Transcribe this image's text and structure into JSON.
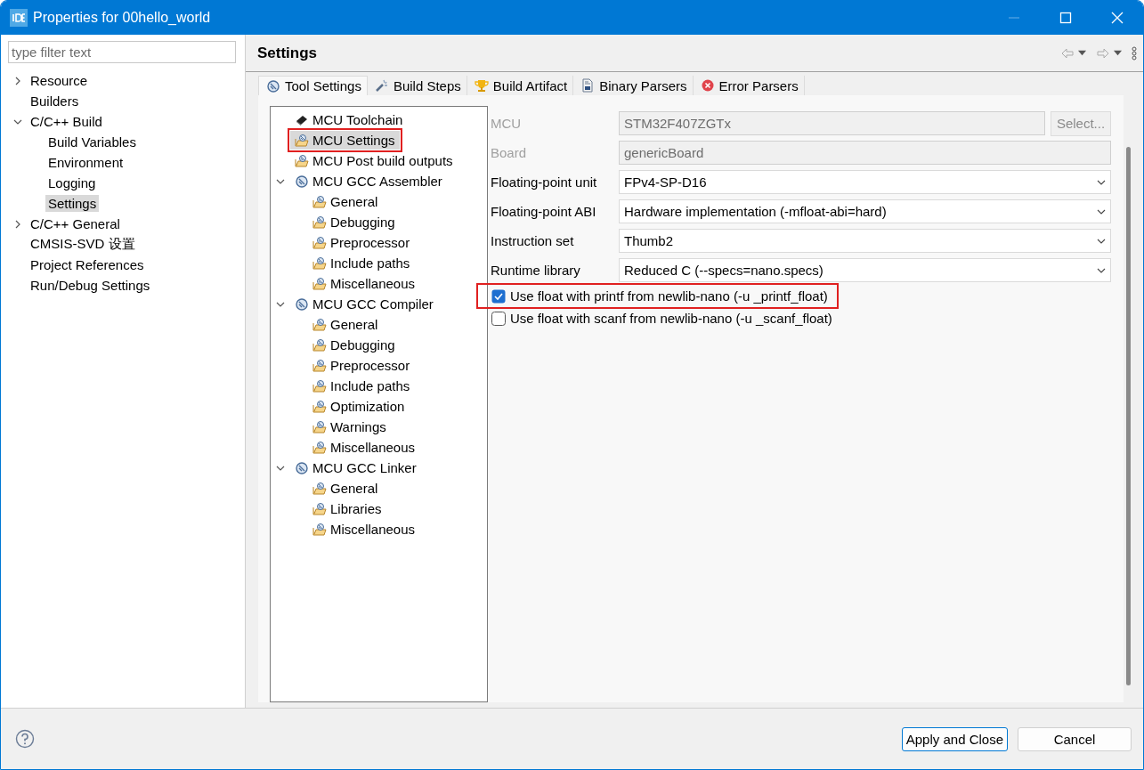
{
  "window": {
    "title": "Properties for 00hello_world"
  },
  "filter": {
    "placeholder": "type filter text"
  },
  "nav_tree": [
    {
      "label": "Resource",
      "expanded": false,
      "selected": false
    },
    {
      "label": "Builders",
      "selected": false
    },
    {
      "label": "C/C++ Build",
      "expanded": true,
      "selected": false,
      "children": [
        {
          "label": "Build Variables",
          "selected": false
        },
        {
          "label": "Environment",
          "selected": false
        },
        {
          "label": "Logging",
          "selected": false
        },
        {
          "label": "Settings",
          "selected": true
        }
      ]
    },
    {
      "label": "C/C++ General",
      "expanded": false,
      "selected": false
    },
    {
      "label": "CMSIS-SVD 设置",
      "selected": false
    },
    {
      "label": "Project References",
      "selected": false
    },
    {
      "label": "Run/Debug Settings",
      "selected": false
    }
  ],
  "page_title": "Settings",
  "tabs": [
    {
      "label": "Tool Settings",
      "kind": "tool",
      "selected": true
    },
    {
      "label": "Build Steps",
      "kind": "steps",
      "selected": false
    },
    {
      "label": "Build Artifact",
      "kind": "artifact",
      "selected": false
    },
    {
      "label": "Binary Parsers",
      "kind": "binary",
      "selected": false
    },
    {
      "label": "Error Parsers",
      "kind": "error",
      "selected": false
    }
  ],
  "tool_tree": [
    {
      "label": "MCU Toolchain",
      "kind": "chip",
      "selected": false,
      "highlighted": false
    },
    {
      "label": "MCU Settings",
      "kind": "option",
      "selected": true,
      "highlighted": true
    },
    {
      "label": "MCU Post build outputs",
      "kind": "option",
      "selected": false,
      "highlighted": false
    },
    {
      "label": "MCU GCC Assembler",
      "kind": "tool",
      "expanded": true,
      "selected": false,
      "highlighted": false,
      "children": [
        {
          "label": "General",
          "kind": "option",
          "selected": false,
          "highlighted": false
        },
        {
          "label": "Debugging",
          "kind": "option",
          "selected": false,
          "highlighted": false
        },
        {
          "label": "Preprocessor",
          "kind": "option",
          "selected": false,
          "highlighted": false
        },
        {
          "label": "Include paths",
          "kind": "option",
          "selected": false,
          "highlighted": false
        },
        {
          "label": "Miscellaneous",
          "kind": "option",
          "selected": false,
          "highlighted": false
        }
      ]
    },
    {
      "label": "MCU GCC Compiler",
      "kind": "tool",
      "expanded": true,
      "selected": false,
      "highlighted": false,
      "children": [
        {
          "label": "General",
          "kind": "option",
          "selected": false,
          "highlighted": false
        },
        {
          "label": "Debugging",
          "kind": "option",
          "selected": false,
          "highlighted": false
        },
        {
          "label": "Preprocessor",
          "kind": "option",
          "selected": false,
          "highlighted": false
        },
        {
          "label": "Include paths",
          "kind": "option",
          "selected": false,
          "highlighted": false
        },
        {
          "label": "Optimization",
          "kind": "option",
          "selected": false,
          "highlighted": false
        },
        {
          "label": "Warnings",
          "kind": "option",
          "selected": false,
          "highlighted": false
        },
        {
          "label": "Miscellaneous",
          "kind": "option",
          "selected": false,
          "highlighted": false
        }
      ]
    },
    {
      "label": "MCU GCC Linker",
      "kind": "tool",
      "expanded": true,
      "selected": false,
      "highlighted": false,
      "children": [
        {
          "label": "General",
          "kind": "option",
          "selected": false,
          "highlighted": false
        },
        {
          "label": "Libraries",
          "kind": "option",
          "selected": false,
          "highlighted": false
        },
        {
          "label": "Miscellaneous",
          "kind": "option",
          "selected": false,
          "highlighted": false
        }
      ]
    }
  ],
  "fields": [
    {
      "label": "MCU",
      "kind": "text",
      "value": "STM32F407ZGTx",
      "disabled": true,
      "button": "Select..."
    },
    {
      "label": "Board",
      "kind": "text",
      "value": "genericBoard",
      "disabled": true
    },
    {
      "label": "Floating-point unit",
      "kind": "dropdown",
      "value": "FPv4-SP-D16",
      "disabled": false
    },
    {
      "label": "Floating-point ABI",
      "kind": "dropdown",
      "value": "Hardware implementation (-mfloat-abi=hard)",
      "disabled": false
    },
    {
      "label": "Instruction set",
      "kind": "dropdown",
      "value": "Thumb2",
      "disabled": false
    },
    {
      "label": "Runtime library",
      "kind": "dropdown",
      "value": "Reduced C (--specs=nano.specs)",
      "disabled": false
    }
  ],
  "checkboxes": [
    {
      "label": "Use float with printf from newlib-nano (-u _printf_float)",
      "checked": true,
      "highlighted": true
    },
    {
      "label": "Use float with scanf from newlib-nano (-u _scanf_float)",
      "checked": false,
      "highlighted": false
    }
  ],
  "buttons": [
    {
      "label": "Apply and Close",
      "default": true
    },
    {
      "label": "Cancel",
      "default": false
    }
  ]
}
